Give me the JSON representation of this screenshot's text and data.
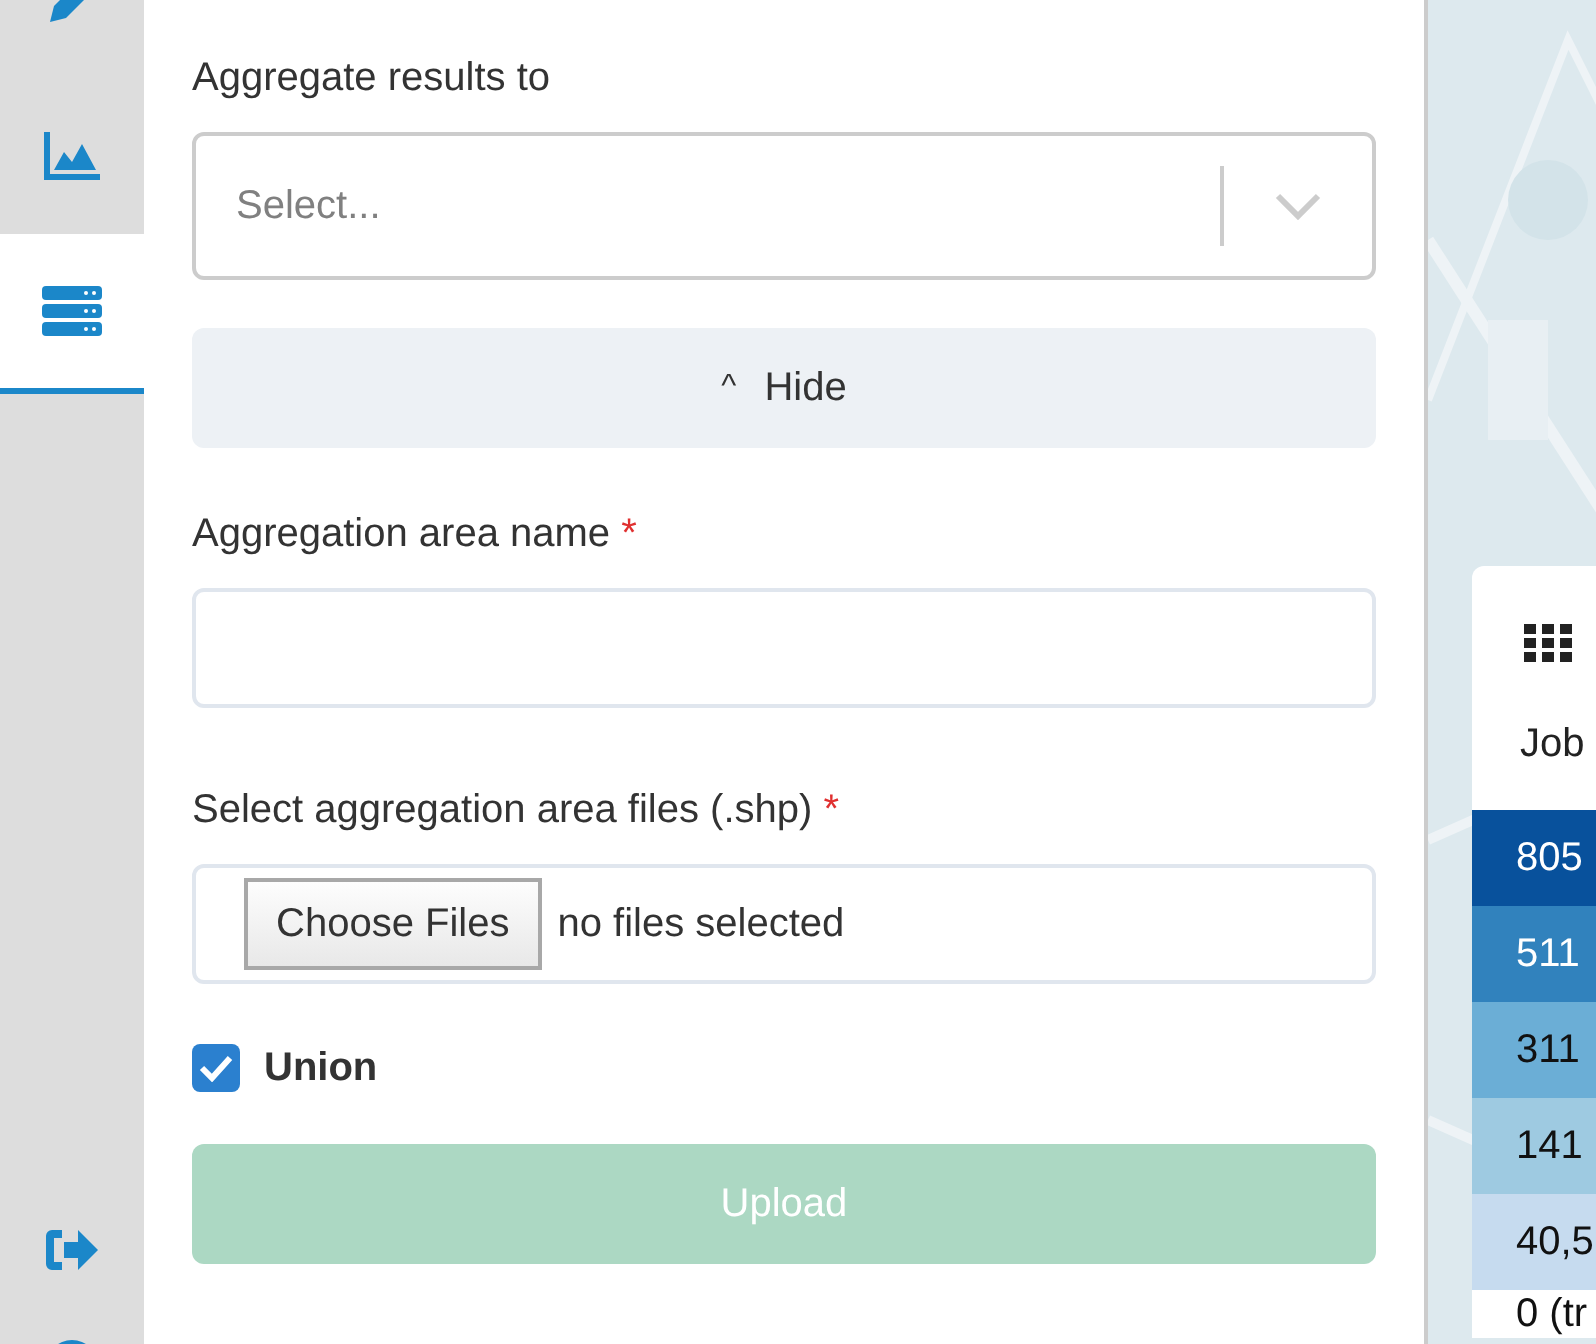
{
  "sidebar": {
    "items": [
      {
        "selected": false
      },
      {
        "selected": false
      },
      {
        "selected": true
      }
    ]
  },
  "form": {
    "aggregate_label": "Aggregate results to",
    "aggregate_select": {
      "placeholder": "Select..."
    },
    "toggle": {
      "icon": "^",
      "label": "Hide",
      "expanded": true
    },
    "area_name": {
      "label": "Aggregation area name",
      "required_mark": "*"
    },
    "files": {
      "label": "Select aggregation area files (.shp)",
      "required_mark": "*",
      "button": "Choose Files",
      "status": "no files selected"
    },
    "union": {
      "label": "Union",
      "checked": true
    },
    "upload": {
      "label": "Upload",
      "disabled": true
    }
  },
  "map": {
    "kind": "picture",
    "legend": {
      "subtitle": "Job",
      "rows": [
        {
          "label": "805",
          "color": "#08519c"
        },
        {
          "label": "511",
          "color": "#3182bd"
        },
        {
          "label": "311",
          "color": "#6baed6"
        },
        {
          "label": "141",
          "color": "#9ecae1"
        },
        {
          "label": "40,5",
          "color": "#c6dbef"
        },
        {
          "label": "0 (tr",
          "color": "#ffffff"
        }
      ]
    }
  }
}
